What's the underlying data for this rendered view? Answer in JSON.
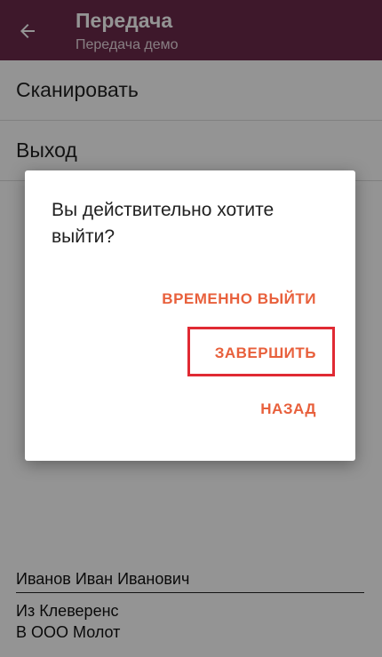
{
  "appbar": {
    "title": "Передача",
    "subtitle": "Передача демо",
    "background": "#6b2a4a",
    "back_icon": "arrow-left-icon"
  },
  "menu": {
    "items": [
      {
        "label": "Сканировать"
      },
      {
        "label": "Выход"
      }
    ]
  },
  "footer": {
    "user": "Иванов Иван Иванович",
    "from_label": "Из Клеверенс",
    "to_label": "В ООО Молот"
  },
  "dialog": {
    "message": "Вы действительно хотите выйти?",
    "buttons": {
      "temp_exit": "ВРЕМЕННО ВЫЙТИ",
      "finish": "ЗАВЕРШИТЬ",
      "back": "НАЗАД"
    },
    "accent_color": "#e8603c",
    "highlight_color": "#e02a33"
  }
}
